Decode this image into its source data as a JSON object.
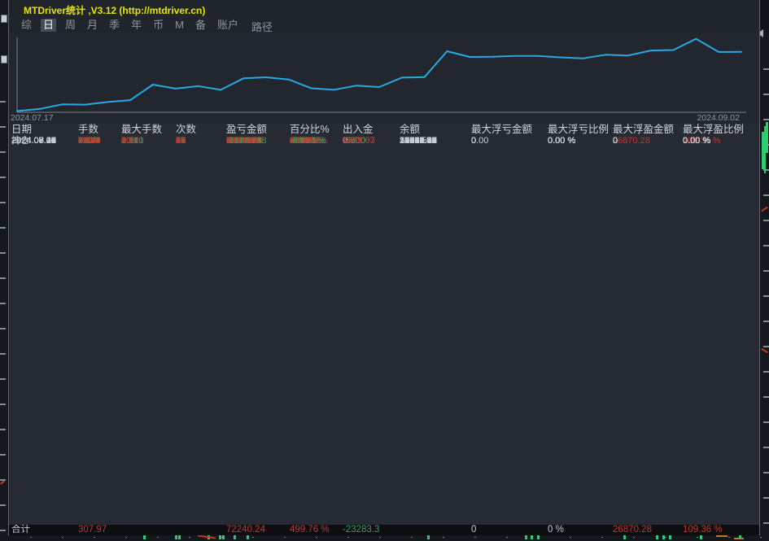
{
  "window": {
    "title": "MTDriver统计 ,V3.12 (http://mtdriver.cn)",
    "menu": {
      "items": [
        "综",
        "日",
        "周",
        "月",
        "季",
        "年",
        "币",
        "M",
        "备",
        "账户"
      ],
      "active_index": 1,
      "path_label": "路径"
    }
  },
  "chart_data": {
    "type": "line",
    "series_name": "累计盈亏",
    "x_start_label": "2024.07.17",
    "x_end_label": "2024.09.02",
    "line_color": "#29a8e2",
    "ylim": [
      0,
      60000
    ],
    "dates": [
      "2024.07.17",
      "2024.07.18",
      "2024.07.19",
      "2024.07.22",
      "2024.07.23",
      "2024.07.24",
      "2024.07.25",
      "2024.07.26",
      "2024.07.29",
      "2024.07.30",
      "2024.07.31",
      "2024.08.01",
      "2024.08.02",
      "2024.08.05",
      "2024.08.06",
      "2024.08.07",
      "2024.08.08",
      "2024.08.09",
      "2024.08.12",
      "2024.08.13",
      "2024.08.14",
      "2024.08.15",
      "2024.08.19",
      "2024.08.20",
      "2024.08.21",
      "2024.08.22",
      "2024.08.23",
      "2024.08.26",
      "2024.08.27",
      "2024.08.28",
      "2024.08.29",
      "2024.08.30",
      "2024.09.02"
    ],
    "values": [
      974.83,
      2634.48,
      6242.21,
      6085.24,
      8149.15,
      9588.83,
      21918.56,
      18798.42,
      20709.56,
      17827.28,
      26873.62,
      27773.84,
      26004.78,
      19001.2,
      17810.64,
      21180.42,
      19968.68,
      27516.04,
      27855.48,
      48415.5,
      43848.62,
      44022.2,
      44695.23,
      44714.48,
      43567.71,
      42733.67,
      45617.14,
      45011.0,
      48962.98,
      49370.65,
      58247.45,
      47783.47,
      47853.34
    ]
  },
  "table": {
    "headers": [
      "日期",
      "手数",
      "最大手数",
      "次数",
      "盈亏金额",
      "百分比%",
      "出入金",
      "余额",
      "最大浮亏金额",
      "最大浮亏比例",
      "最大浮盈金额",
      "最大浮盈比例"
    ],
    "rows": [
      [
        "持仓",
        "11.77",
        "1.00",
        "34",
        "24386.91",
        "99.25 %",
        "0",
        "24570.03",
        "0.00",
        "0.00 %",
        "26870.28",
        "109.36 %"
      ],
      [
        "2024.09.02",
        "0.12",
        "0.11",
        "2",
        "69.87",
        "0.29 %",
        "0",
        "24570.03",
        "0",
        "0.00 %",
        "0",
        "0.00 %"
      ],
      [
        "2024.08.30",
        "11.38",
        "3.00",
        "36",
        "-10463.98",
        "-29.93 %",
        "0",
        "24500.16",
        "0",
        "0.00 %",
        "0",
        "0.00 %"
      ],
      [
        "2024.08.29",
        "11.24",
        "2.00",
        "21",
        "8876.80",
        "34.03 %",
        "0",
        "34964.14",
        "0",
        "0.00 %",
        "0",
        "0.00 %"
      ],
      [
        "2024.08.28",
        "3.30",
        "3.20",
        "2",
        "407.67",
        "1.59 %",
        "0",
        "26087.34",
        "0",
        "0.00 %",
        "0",
        "0.00 %"
      ],
      [
        "2024.08.27",
        "6.51",
        "1.50",
        "15",
        "3951.98",
        "18.19 %",
        "0",
        "25679.67",
        "0",
        "0.00 %",
        "0",
        "0.00 %"
      ],
      [
        "2024.08.26",
        "0.62",
        "0.51",
        "2",
        "-606.15",
        "-2.71 %",
        "-6800",
        "21727.69",
        "0",
        "0.00 %",
        "0",
        "0.00 %"
      ],
      [
        "2024.08.23",
        "5.54",
        "1.00",
        "31",
        "2883.47",
        "10.98 %",
        "0",
        "29133.84",
        "0",
        "0.00 %",
        "0",
        "0.00 %"
      ],
      [
        "2024.08.22",
        "3.19",
        "0.55",
        "17",
        "-834.04",
        "-3.08 %",
        "0",
        "26250.37",
        "0",
        "0.00 %",
        "0",
        "0.00 %"
      ],
      [
        "2024.08.21",
        "5.76",
        "2.00",
        "18",
        "-1146.77",
        "-4.06 %",
        "0",
        "27084.41",
        "0",
        "0.00 %",
        "0",
        "0.00 %"
      ],
      [
        "2024.08.20",
        "4.80",
        "2.00",
        "4",
        "19.25",
        "0.07 %",
        "0",
        "28231.18",
        "0",
        "0.00 %",
        "0",
        "0.00 %"
      ],
      [
        "2024.08.19",
        "1.60",
        "1.00",
        "3",
        "673.03",
        "2.44 %",
        "0",
        "28211.93",
        "0",
        "0.00 %",
        "0",
        "0.00 %"
      ],
      [
        "2024.08.15",
        "1.32",
        "1.00",
        "4",
        "173.58",
        "0.63 %",
        "0",
        "27538.90",
        "0",
        "0.00 %",
        "0",
        "0.00 %"
      ],
      [
        "2024.08.14",
        "2.17",
        "1.50",
        "19",
        "-4566.88",
        "-14.30 %",
        "0",
        "27365.32",
        "0",
        "0.00 %",
        "0",
        "0.00 %"
      ],
      [
        "2024.08.13",
        "5.04",
        "2.50",
        "15",
        "20560.02",
        "180.79 %",
        "-6800",
        "31932.20",
        "0",
        "0.00 %",
        "0",
        "0.00 %"
      ],
      [
        "2024.08.12",
        "1.02",
        "0.50",
        "4",
        "339.44",
        "1.90 %",
        "-6700",
        "18172.18",
        "0",
        "0.00 %",
        "0",
        "0.00 %"
      ],
      [
        "2024.08.09",
        "7.16",
        "3.00",
        "20",
        "7547.36",
        "44.43 %",
        "-6500",
        "24532.74",
        "0",
        "0.00 %",
        "0",
        "0.00 %"
      ],
      [
        "2024.08.08",
        "20.74",
        "3.00",
        "23",
        "-1211.74",
        "-4.91 %",
        "0",
        "23485.38",
        "0",
        "0.00 %",
        "0",
        "0.00 %"
      ],
      [
        "2024.08.07",
        "12.83",
        "3.00",
        "16",
        "3369.78",
        "15.80 %",
        "0",
        "24697.12",
        "0",
        "0.00 %",
        "0",
        "0.00 %"
      ],
      [
        "2024.08.06",
        "2.84",
        "0.77",
        "25",
        "-1190.56",
        "-5.29 %",
        "0",
        "21327.34",
        "0",
        "0.00 %",
        "0",
        "0.00 %"
      ],
      [
        "2024.08.05",
        "9.02",
        "1.00",
        "36",
        "-7003.58",
        "-23.72 %",
        "0",
        "22517.90",
        "0",
        "0.00 %",
        "0",
        "0.00 %"
      ],
      [
        "2024.08.02",
        "7.72",
        "1.11",
        "23",
        "-1769.06",
        "-5.65 %",
        "0",
        "29521.48",
        "0",
        "0.00 %",
        "0",
        "0.00 %"
      ],
      [
        "2024.08.01",
        "37.97",
        "10.01",
        "38",
        "900.22",
        "2.96 %",
        "0",
        "31290.54",
        "0",
        "0.00 %",
        "0",
        "0.00 %"
      ],
      [
        "2024.07.31",
        "6.74",
        "2.00",
        "16",
        "9046.34",
        "42.38 %",
        "-6300",
        "30390.32",
        "0",
        "0.00 %",
        "0",
        "0.00 %"
      ],
      [
        "2024.07.30",
        "3.79",
        "2.20",
        "17",
        "-2882.28",
        "-9.44 %",
        "0",
        "27643.98",
        "0",
        "0.00 %",
        "0",
        "0.00 %"
      ],
      [
        "2024.07.29",
        "12.55",
        "3.00",
        "8",
        "1911.14",
        "6.68 %",
        "0",
        "30526.26",
        "0",
        "0.00 %",
        "0",
        "0.00 %"
      ],
      [
        "2024.07.26",
        "31.70",
        "10.00",
        "24",
        "-3120.14",
        "-9.83 %",
        "0",
        "28615.12",
        "0",
        "0.00 %",
        "0",
        "0.00 %"
      ],
      [
        "2024.07.25",
        "41.15",
        "10.01",
        "53",
        "12329.73",
        "63.54 %",
        "0",
        "31735.26",
        "0",
        "0.00 %",
        "0",
        "0.00 %"
      ],
      [
        "2024.07.24",
        "13.13",
        "5.00",
        "9",
        "1439.68",
        "8.01 %",
        "0",
        "19405.53",
        "0",
        "0.00 %",
        "0",
        "0.00 %"
      ],
      [
        "2024.07.23",
        "5.43",
        "1.00",
        "12",
        "2063.91",
        "12.98 %",
        "0",
        "17965.85",
        "0",
        "0.00 %",
        "0",
        "0.00 %"
      ],
      [
        "2024.07.22",
        "7.29",
        "1.01",
        "16",
        "-156.97",
        "-0.98 %",
        "0",
        "15901.94",
        "0",
        "0.00 %",
        "0",
        "0.00 %"
      ],
      [
        "2024.07.19",
        "1.66",
        "1.15",
        "7",
        "3607.73",
        "28.98 %",
        "0",
        "16058.91",
        "0",
        "0.00 %",
        "0",
        "0.00 %"
      ],
      [
        "2024.07.18",
        "3.96",
        "1.00",
        "13",
        "1659.65",
        "15.38 %",
        "5457.03",
        "12451.18",
        "0",
        "0.00 %",
        "0",
        "0.00 %"
      ],
      [
        "2024.07.17",
        "6.91",
        "2.00",
        "24",
        "974.83",
        "22.36 %",
        "4359.67",
        "5334.50",
        "0",
        "0.00 %",
        "0",
        "0.00 %"
      ]
    ],
    "total_row": [
      "合计",
      "307.97",
      "",
      "",
      "72240.24",
      "499.76 %",
      "-23283.3",
      "",
      "0",
      "0 %",
      "26870.28",
      "109.36 %"
    ]
  },
  "colors": {
    "profit": "#bd3a31",
    "loss": "#2ea262",
    "neutral": "#c6ccd4",
    "equity_line": "#29a8e2",
    "title": "#e6e600"
  }
}
